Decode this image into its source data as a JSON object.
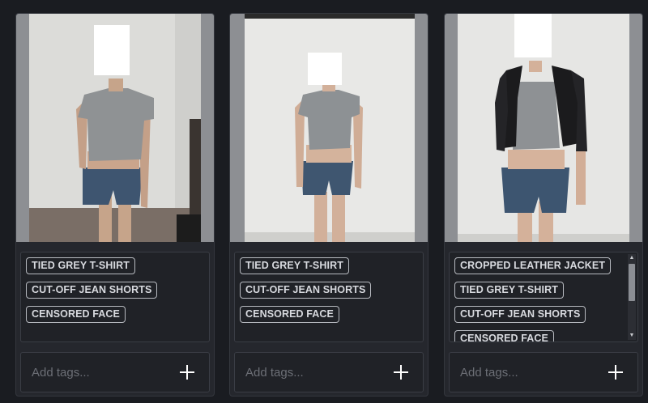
{
  "cards": [
    {
      "image_alt": "person wearing tied grey t-shirt and cut-off jean shorts",
      "tags": [
        "TIED GREY T-SHIRT",
        "CUT-OFF JEAN SHORTS",
        "CENSORED FACE"
      ],
      "add_placeholder": "Add tags...",
      "add_icon": "plus-icon"
    },
    {
      "image_alt": "mannequin wearing tied grey t-shirt and cut-off jean shorts",
      "tags": [
        "TIED GREY T-SHIRT",
        "CUT-OFF JEAN SHORTS",
        "CENSORED FACE"
      ],
      "add_placeholder": "Add tags...",
      "add_icon": "plus-icon"
    },
    {
      "image_alt": "mannequin wearing cropped leather jacket, tied grey t-shirt and cut-off jean shorts",
      "tags": [
        "CROPPED LEATHER JACKET",
        "TIED GREY T-SHIRT",
        "CUT-OFF JEAN SHORTS",
        "CENSORED FACE"
      ],
      "add_placeholder": "Add tags...",
      "add_icon": "plus-icon",
      "has_scrollbar": true
    }
  ],
  "colors": {
    "page_bg": "#1a1c21",
    "card_bg": "#25272d",
    "tag_border": "#b7bac0",
    "tag_text": "#d8dadf"
  }
}
